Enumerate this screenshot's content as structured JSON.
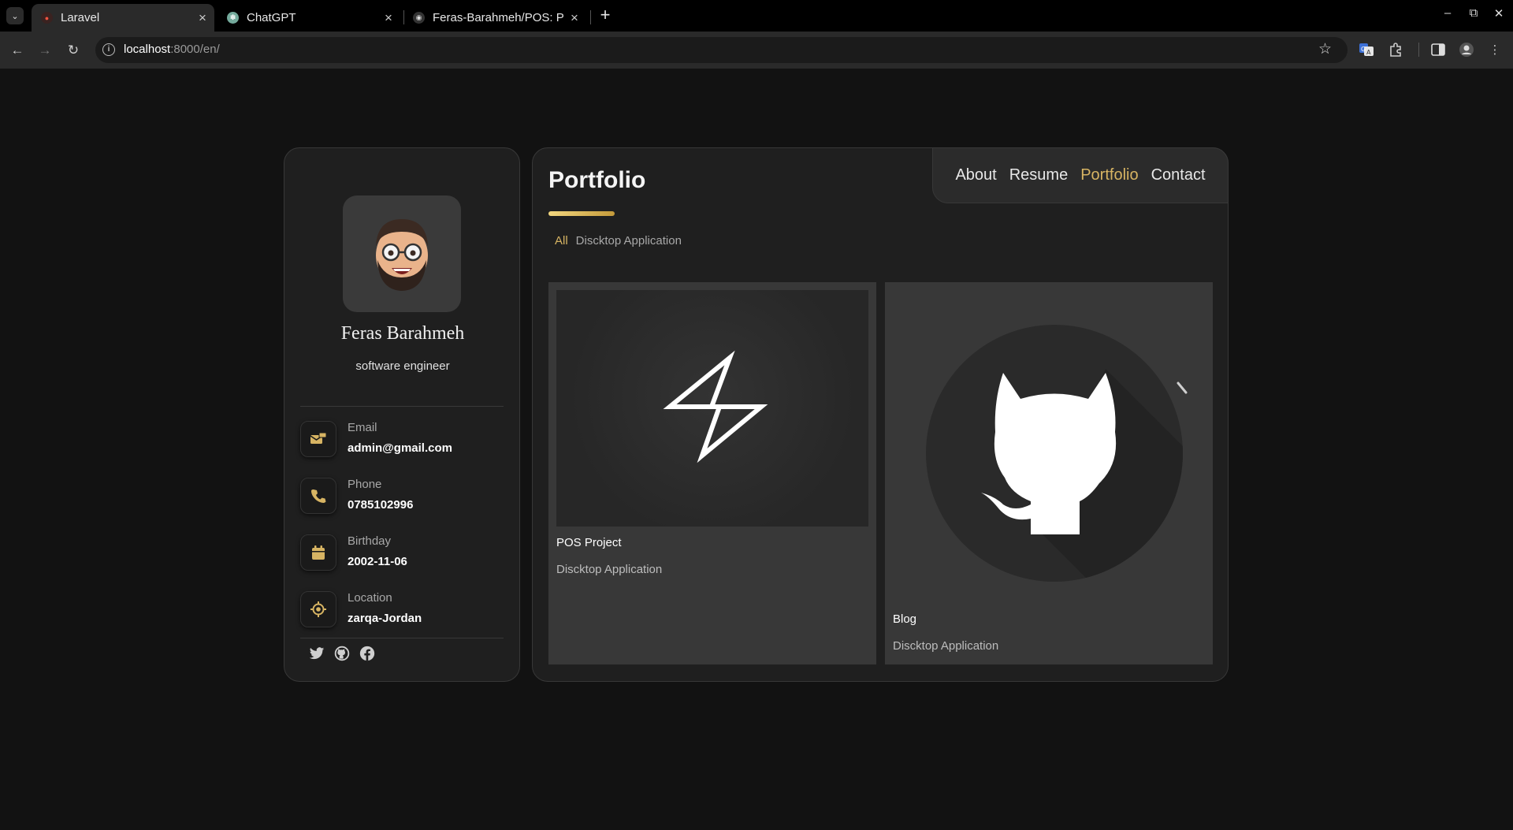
{
  "browser": {
    "tabs": [
      {
        "title": "Laravel",
        "active": true
      },
      {
        "title": "ChatGPT",
        "active": false
      },
      {
        "title": "Feras-Barahmeh/POS: P",
        "active": false
      }
    ],
    "url_host": "localhost",
    "url_rest": ":8000/en/"
  },
  "profile": {
    "name": "Feras Barahmeh",
    "title": "software engineer",
    "contacts": [
      {
        "label": "Email",
        "value": "admin@gmail.com",
        "icon": "mail-icon"
      },
      {
        "label": "Phone",
        "value": "0785102996",
        "icon": "phone-icon"
      },
      {
        "label": "Birthday",
        "value": "2002-11-06",
        "icon": "calendar-icon"
      },
      {
        "label": "Location",
        "value": "zarqa-Jordan",
        "icon": "location-icon"
      }
    ],
    "socials": [
      "twitter-icon",
      "github-icon",
      "facebook-icon"
    ]
  },
  "nav": {
    "items": [
      "About",
      "Resume",
      "Portfolio",
      "Contact"
    ],
    "active": "Portfolio"
  },
  "portfolio": {
    "title": "Portfolio",
    "filters": [
      "All",
      "Discktop Application"
    ],
    "active_filter": "All",
    "projects": [
      {
        "title": "POS Project",
        "category": "Discktop Application",
        "image": "lightning-logo"
      },
      {
        "title": "Blog",
        "category": "Discktop Application",
        "image": "github-octocat-logo"
      }
    ]
  },
  "colors": {
    "accent": "#d7b463",
    "background": "#121212",
    "card": "#1f1f1f"
  }
}
